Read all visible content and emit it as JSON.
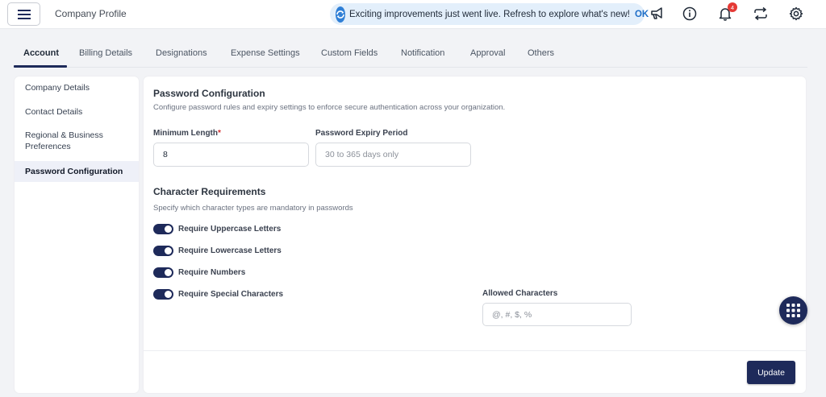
{
  "header": {
    "title": "Company Profile",
    "banner_text": "Exciting improvements just went live. Refresh to explore what's new!",
    "banner_ok": "OK",
    "notification_count": "4",
    "icons": [
      "menu-icon",
      "megaphone-icon",
      "info-icon",
      "bell-icon",
      "switch-icon",
      "gear-icon"
    ]
  },
  "tabs": [
    "Account",
    "Billing Details",
    "Designations",
    "Expense Settings",
    "Custom Fields",
    "Notification",
    "Approval",
    "Others"
  ],
  "sidebar": {
    "items": [
      "Company Details",
      "Contact Details",
      "Regional & Business Preferences",
      "Password Configuration"
    ],
    "active": "Password Configuration"
  },
  "password": {
    "title": "Password Configuration",
    "description": "Configure password rules and expiry settings to enforce secure authentication across your organization.",
    "min_length_label": "Minimum Length",
    "min_length_required": "*",
    "min_length_value": "8",
    "expiry_label": "Password Expiry Period",
    "expiry_placeholder": "30 to 365 days only"
  },
  "characters": {
    "title": "Character Requirements",
    "description": "Specify which character types are mandatory in passwords",
    "toggles": [
      "Require Uppercase Letters",
      "Require Lowercase Letters",
      "Require Numbers",
      "Require Special Characters"
    ],
    "allowed_label": "Allowed Characters",
    "allowed_placeholder": "@, #, $, %"
  },
  "actions": {
    "update": "Update"
  },
  "colors": {
    "primary": "#1e2a5a",
    "banner_bg": "#e3effb",
    "badge": "#e53935",
    "link": "#1f6fc8"
  }
}
